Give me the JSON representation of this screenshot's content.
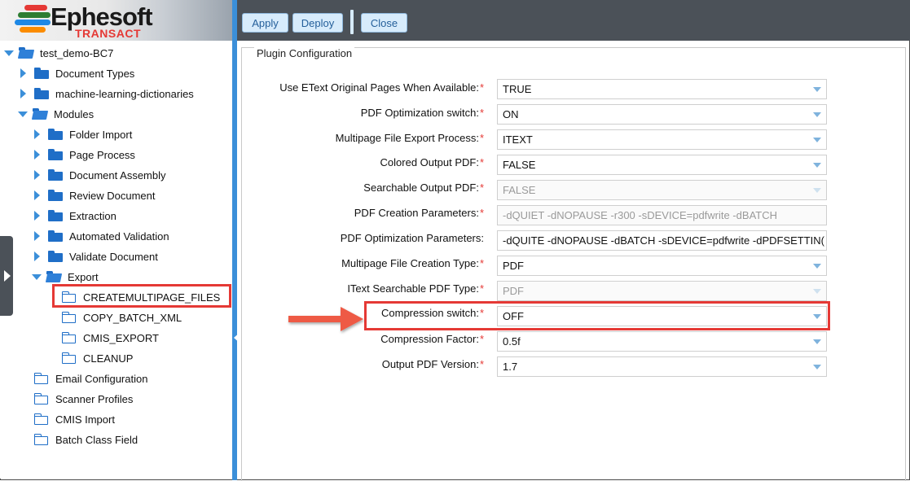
{
  "brand": {
    "name": "Ephesoft",
    "subtitle": "TRANSACT",
    "colors": [
      "#e53935",
      "#2e7d32",
      "#1e88e5",
      "#fb8c00"
    ]
  },
  "toolbar": {
    "apply_label": "Apply",
    "deploy_label": "Deploy",
    "close_label": "Close"
  },
  "tree": {
    "root": "test_demo-BC7",
    "items": [
      "Document Types",
      "machine-learning-dictionaries",
      "Modules",
      "Folder Import",
      "Page Process",
      "Document Assembly",
      "Review Document",
      "Extraction",
      "Automated Validation",
      "Validate Document",
      "Export",
      "CREATEMULTIPAGE_FILES",
      "COPY_BATCH_XML",
      "CMIS_EXPORT",
      "CLEANUP",
      "Email Configuration",
      "Scanner Profiles",
      "CMIS Import",
      "Batch Class Field"
    ]
  },
  "panel": {
    "legend": "Plugin Configuration",
    "required_mark": "*",
    "rows": [
      {
        "label": "Use EText Original Pages When Available:",
        "value": "TRUE",
        "required": true
      },
      {
        "label": "PDF Optimization switch:",
        "value": "ON",
        "required": true
      },
      {
        "label": "Multipage File Export Process:",
        "value": "ITEXT",
        "required": true
      },
      {
        "label": "Colored Output PDF:",
        "value": "FALSE",
        "required": true
      },
      {
        "label": "Searchable Output PDF:",
        "value": "FALSE",
        "required": true
      },
      {
        "label": "PDF Creation Parameters:",
        "value": "-dQUIET -dNOPAUSE -r300 -sDEVICE=pdfwrite -dBATCH",
        "required": true
      },
      {
        "label": "PDF Optimization Parameters:",
        "value": "-dQUITE -dNOPAUSE -dBATCH -sDEVICE=pdfwrite -dPDFSETTIN(",
        "required": false
      },
      {
        "label": "Multipage File Creation Type:",
        "value": "PDF",
        "required": true
      },
      {
        "label": "IText Searchable PDF Type:",
        "value": "PDF",
        "required": true
      },
      {
        "label": "Compression switch:",
        "value": "OFF",
        "required": true
      },
      {
        "label": "Compression Factor:",
        "value": "0.5f",
        "required": true
      },
      {
        "label": "Output PDF Version:",
        "value": "1.7",
        "required": true
      }
    ]
  },
  "accent_colors": {
    "highlight_red": "#e53935",
    "splitter_blue": "#3b8fd9",
    "topbar": "#4b5158"
  }
}
